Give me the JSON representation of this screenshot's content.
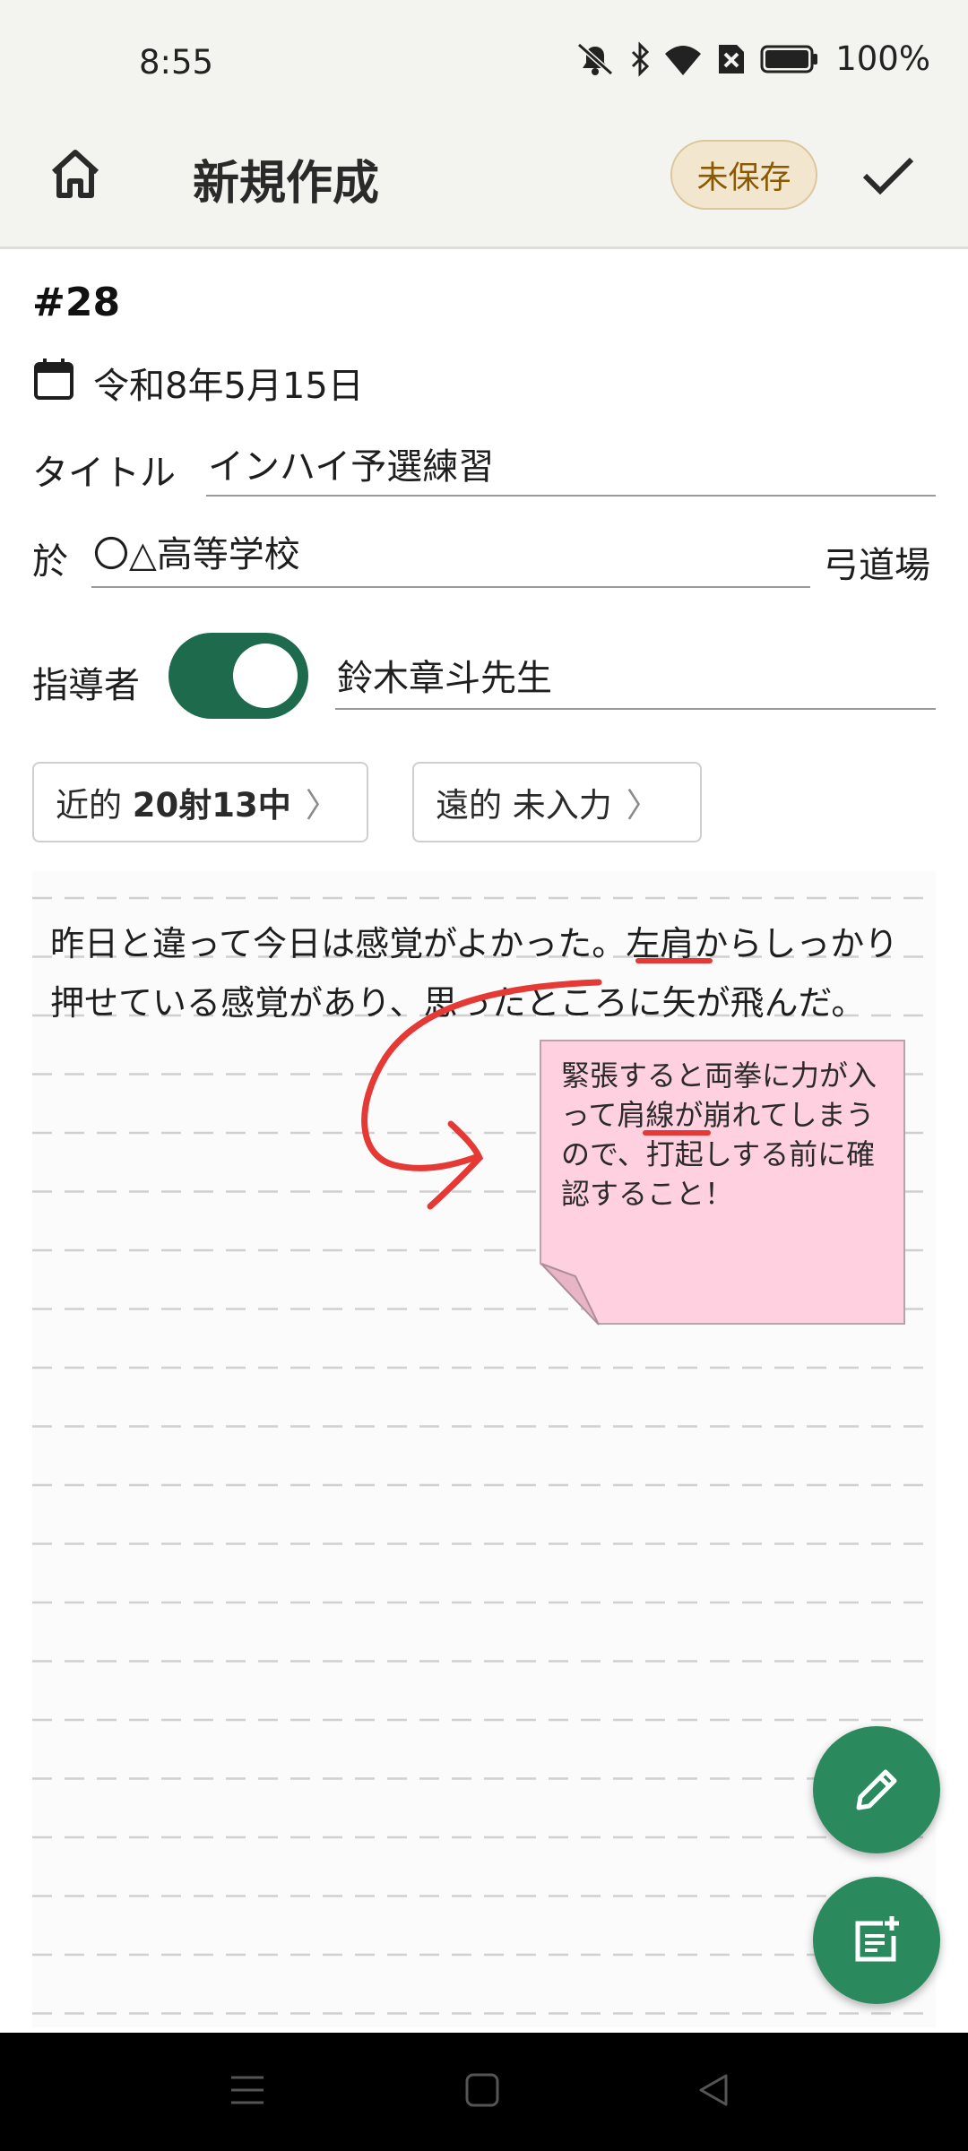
{
  "status_bar": {
    "time": "8:55",
    "battery": "100%",
    "icons": [
      "mute-icon",
      "bluetooth-icon",
      "wifi-icon",
      "no-sim-icon",
      "battery-icon"
    ]
  },
  "app_bar": {
    "home_icon": "home-icon",
    "title": "新規作成",
    "unsaved_badge": "未保存",
    "confirm_icon": "check-icon"
  },
  "record": {
    "number": "#28",
    "date_icon": "calendar-icon",
    "date": "令和8年5月15日",
    "title_label": "タイトル",
    "title_value": "インハイ予選練習",
    "place_prefix": "於",
    "place_value": "〇△高等学校",
    "place_suffix": "弓道場",
    "instructor_label": "指導者",
    "instructor_toggle_on": true,
    "instructor_value": "鈴木章斗先生"
  },
  "chips": {
    "near": {
      "label": "近的",
      "value": "20射13中",
      "chevron": "〉"
    },
    "far": {
      "label": "遠的",
      "value": "未入力",
      "chevron": "〉"
    }
  },
  "note": {
    "line1_a": "昨日と違って今日は感覚がよかった。",
    "line1_highlight": "左肩",
    "line1_b": "からしっかり",
    "line2": "押せている感覚があり、思ったところに矢が飛んだ。"
  },
  "sticky_note": {
    "part_a": "緊張すると両拳に力が入って",
    "highlight": "肩線",
    "part_b": "が崩れてしまうので、打起しする前に確認すること！",
    "color": "#ffd0e0"
  },
  "fabs": {
    "edit_icon": "pencil-icon",
    "add_note_icon": "add-note-icon",
    "color": "#2a8a5e"
  },
  "nav": {
    "icons": [
      "menu-icon",
      "home-square-icon",
      "back-icon"
    ]
  },
  "colors": {
    "accent": "#1d6a4d",
    "ink": "#e53935",
    "badge_bg": "#f2e6cf",
    "badge_text": "#8b5a00"
  }
}
